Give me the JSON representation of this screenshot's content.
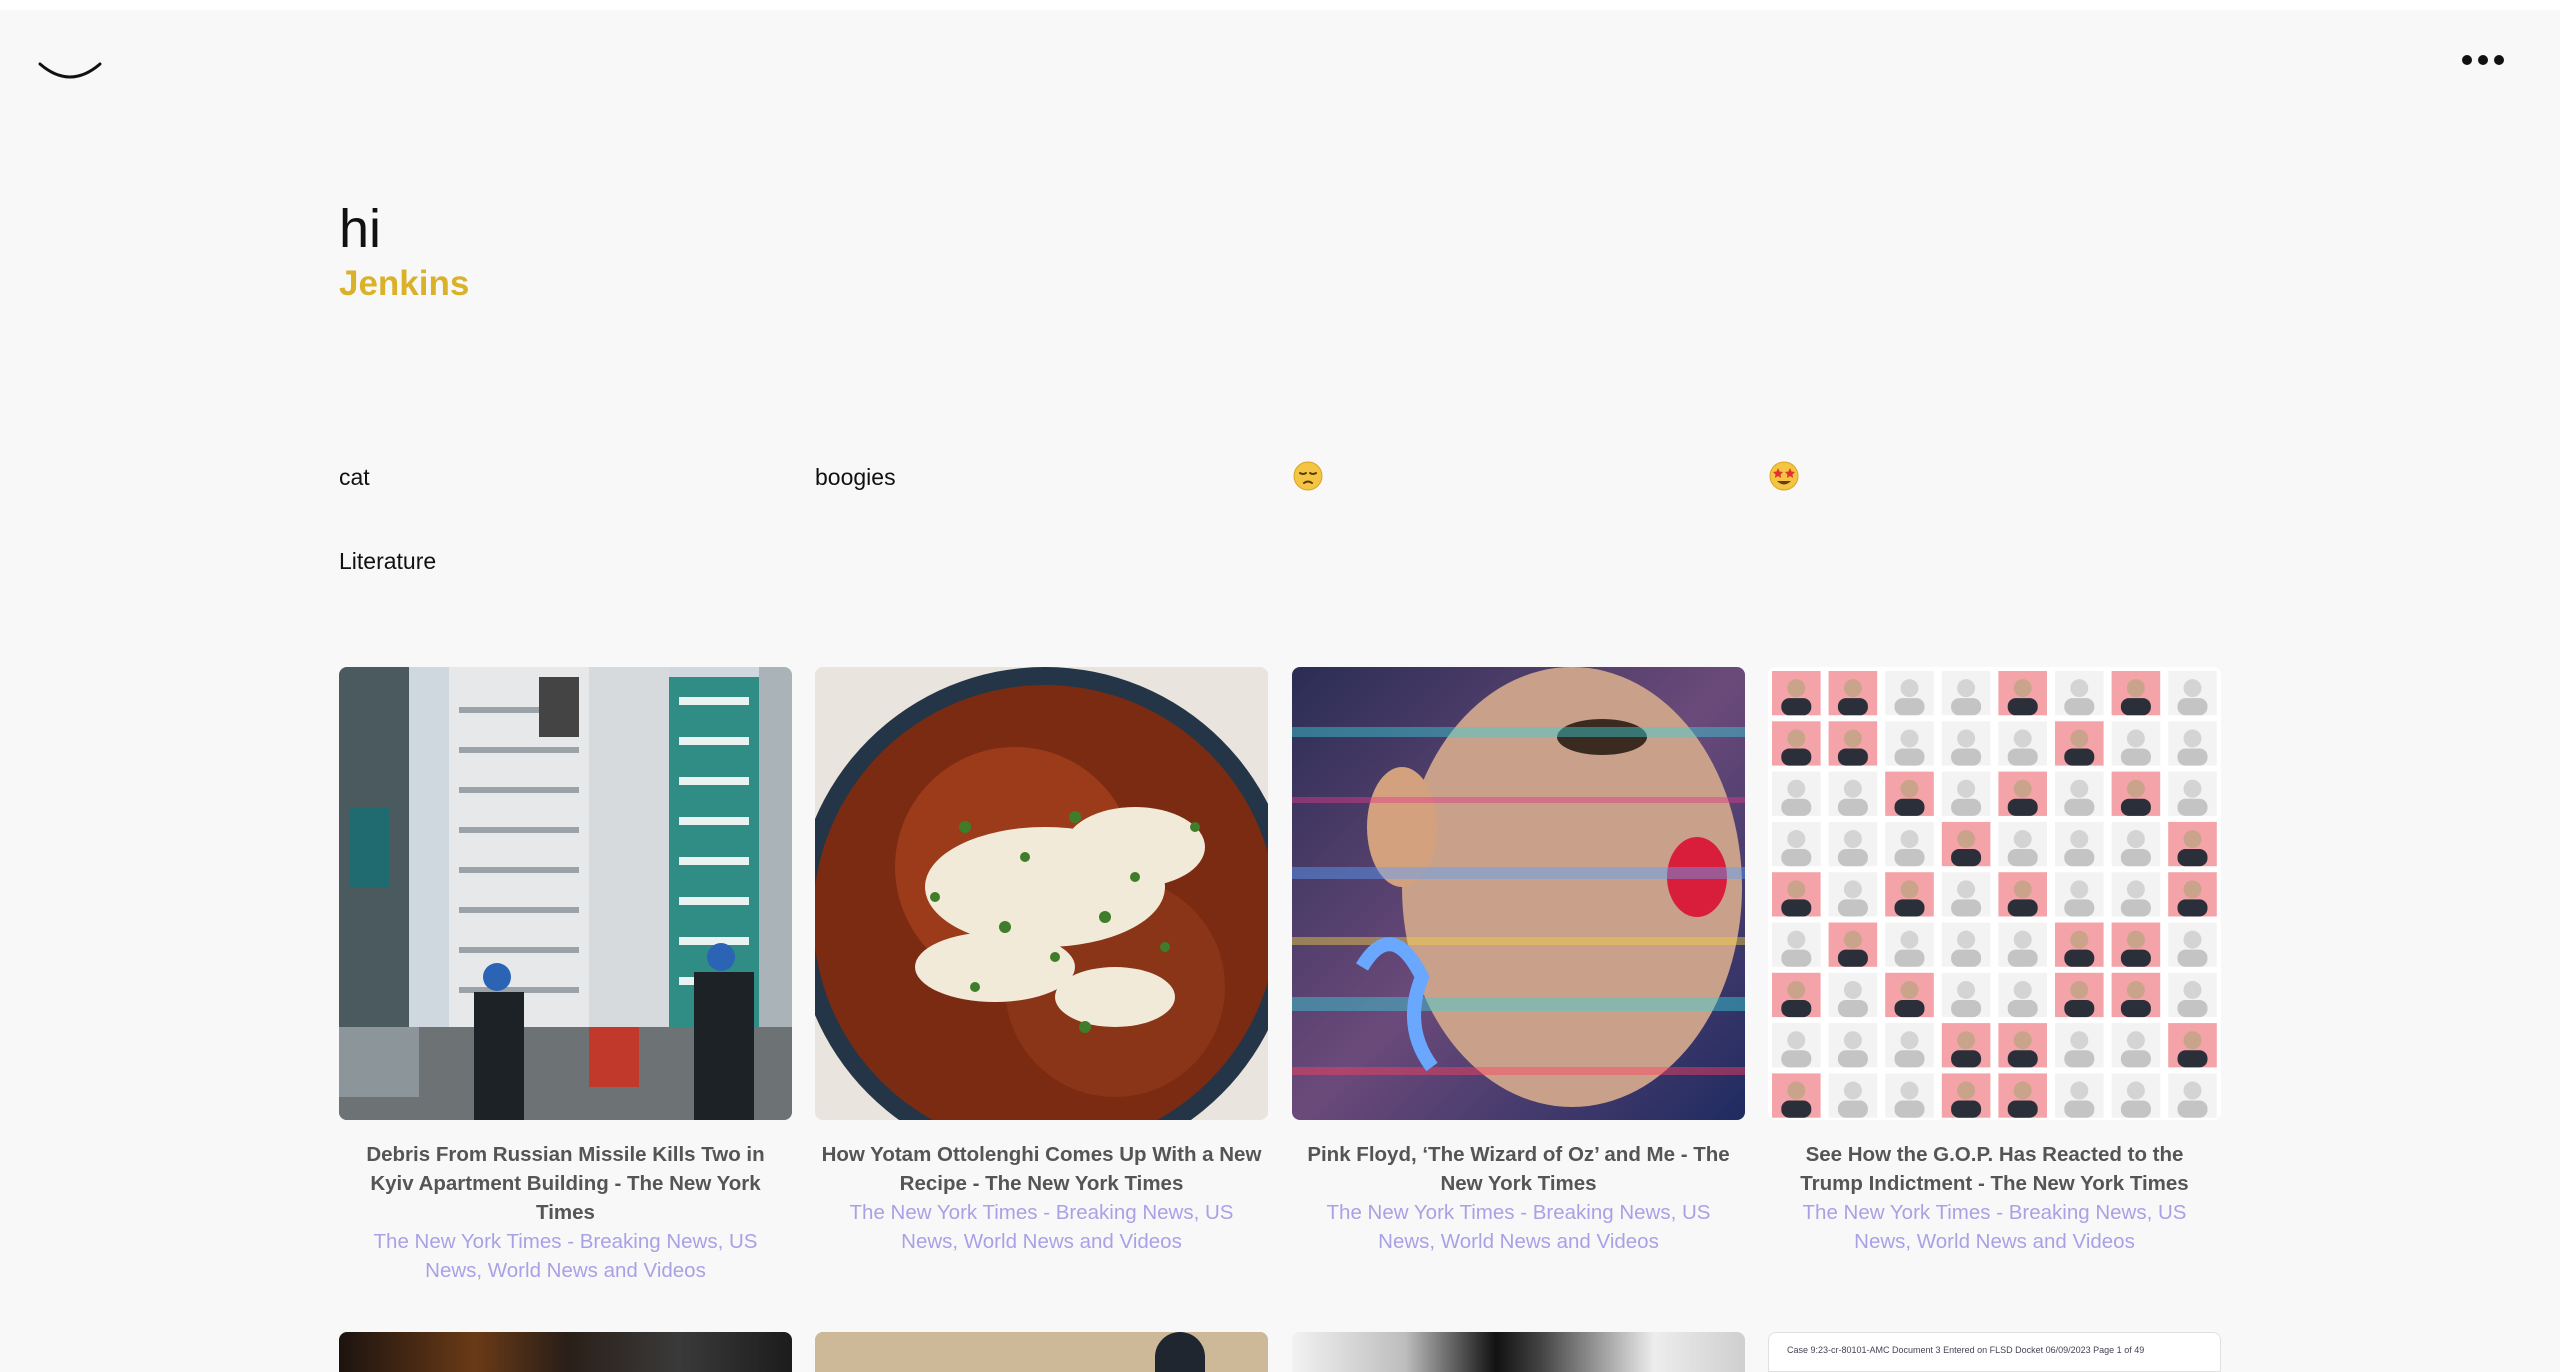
{
  "header": {
    "logo_icon": "smile-arc-icon",
    "menu_icon": "more-dots-icon"
  },
  "greeting": {
    "hi": "hi",
    "name": "Jenkins",
    "name_color": "#d9b22a"
  },
  "links": {
    "cat": "cat",
    "boogies": "boogies",
    "emoji_1": "😔",
    "emoji_2": "🤩",
    "literature": "Literature"
  },
  "cards": [
    {
      "title": "Debris From Russian Missile Kills Two in Kyiv Apartment Building - The New York Times",
      "source": "The New York Times - Breaking News, US News, World News and Videos"
    },
    {
      "title": "How Yotam Ottolenghi Comes Up With a New Recipe - The New York Times",
      "source": "The New York Times - Breaking News, US News, World News and Videos"
    },
    {
      "title": "Pink Floyd, ‘The Wizard of Oz’ and Me - The New York Times",
      "source": "The New York Times - Breaking News, US News, World News and Videos"
    },
    {
      "title": "See How the G.O.P. Has Reacted to the Trump Indictment - The New York Times",
      "source": "The New York Times - Breaking News, US News, World News and Videos"
    }
  ],
  "second_row_partial": {
    "doc_header_text": "Case 9:23-cr-80101-AMC   Document 3   Entered on FLSD Docket 06/09/2023   Page 1 of 49"
  }
}
